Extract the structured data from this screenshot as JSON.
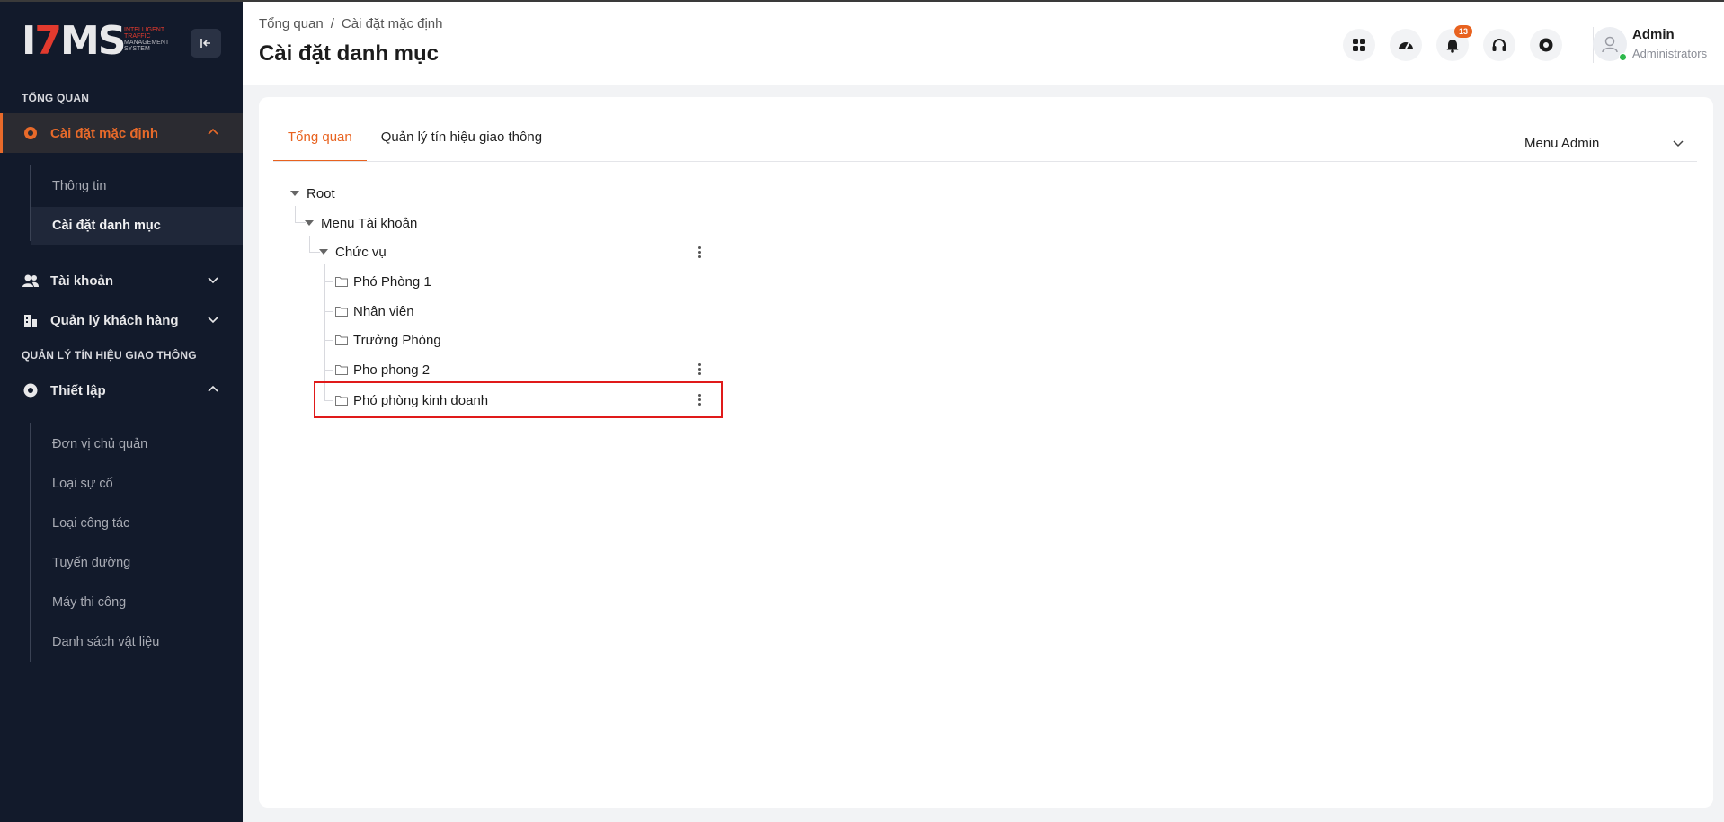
{
  "app": {
    "logo_text_main": "ITMS",
    "logo_sub_1": "INTELLIGENT",
    "logo_sub_2": "TRAFFIC",
    "logo_sub_3": "MANAGEMENT",
    "logo_sub_4": "SYSTEM",
    "accent_color": "#e8621f"
  },
  "sidebar": {
    "section_overview": "TỔNG QUAN",
    "section_traffic": "QUẢN LÝ TÍN HIỆU GIAO THÔNG",
    "default_settings": {
      "label": "Cài đặt mặc định",
      "icon": "gear-icon",
      "children": [
        {
          "label": "Thông tin"
        },
        {
          "label": "Cài đặt danh mục"
        }
      ]
    },
    "account": {
      "label": "Tài khoản",
      "icon": "users-icon"
    },
    "customers": {
      "label": "Quản lý khách hàng",
      "icon": "building-icon"
    },
    "setup": {
      "label": "Thiết lập",
      "icon": "cog-icon",
      "children": [
        {
          "label": "Đơn vị chủ quản"
        },
        {
          "label": "Loại sự cố"
        },
        {
          "label": "Loại công tác"
        },
        {
          "label": "Tuyến đường"
        },
        {
          "label": "Máy thi công"
        },
        {
          "label": "Danh sách vật liệu"
        }
      ]
    }
  },
  "header": {
    "breadcrumb": [
      "Tổng quan",
      "/",
      "Cài đặt mặc định"
    ],
    "title": "Cài đặt danh mục",
    "notification_count": "13",
    "user_name": "Admin",
    "user_role": "Administrators"
  },
  "content": {
    "tabs": [
      {
        "label": "Tổng quan",
        "active": true
      },
      {
        "label": "Quản lý tín hiệu giao thông",
        "active": false
      }
    ],
    "menu_select": "Menu Admin",
    "tree": {
      "root": "Root",
      "menu_account": "Menu Tài khoản",
      "position": "Chức vụ",
      "items": [
        "Phó Phòng 1",
        "Nhân viên",
        "Trưởng Phòng",
        "Pho phong 2",
        "Phó phòng kinh doanh"
      ]
    }
  }
}
